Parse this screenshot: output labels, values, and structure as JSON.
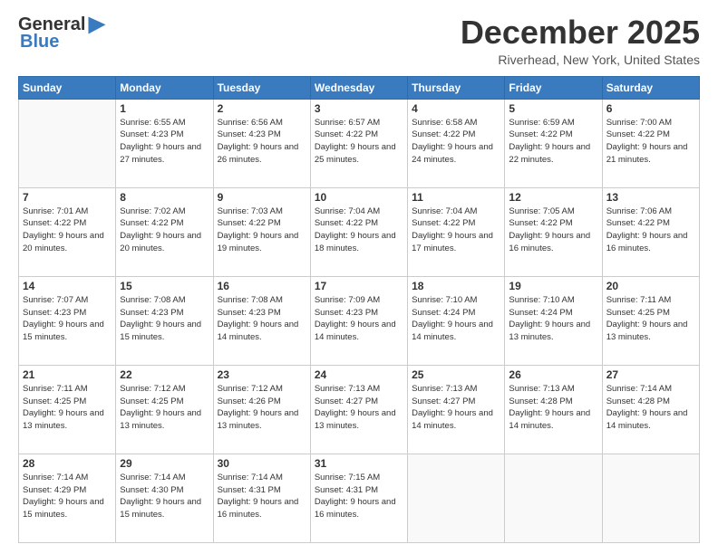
{
  "logo": {
    "general": "General",
    "blue": "Blue"
  },
  "title": "December 2025",
  "location": "Riverhead, New York, United States",
  "weekdays": [
    "Sunday",
    "Monday",
    "Tuesday",
    "Wednesday",
    "Thursday",
    "Friday",
    "Saturday"
  ],
  "weeks": [
    [
      {
        "day": "",
        "sunrise": "",
        "sunset": "",
        "daylight": ""
      },
      {
        "day": "1",
        "sunrise": "Sunrise: 6:55 AM",
        "sunset": "Sunset: 4:23 PM",
        "daylight": "Daylight: 9 hours and 27 minutes."
      },
      {
        "day": "2",
        "sunrise": "Sunrise: 6:56 AM",
        "sunset": "Sunset: 4:23 PM",
        "daylight": "Daylight: 9 hours and 26 minutes."
      },
      {
        "day": "3",
        "sunrise": "Sunrise: 6:57 AM",
        "sunset": "Sunset: 4:22 PM",
        "daylight": "Daylight: 9 hours and 25 minutes."
      },
      {
        "day": "4",
        "sunrise": "Sunrise: 6:58 AM",
        "sunset": "Sunset: 4:22 PM",
        "daylight": "Daylight: 9 hours and 24 minutes."
      },
      {
        "day": "5",
        "sunrise": "Sunrise: 6:59 AM",
        "sunset": "Sunset: 4:22 PM",
        "daylight": "Daylight: 9 hours and 22 minutes."
      },
      {
        "day": "6",
        "sunrise": "Sunrise: 7:00 AM",
        "sunset": "Sunset: 4:22 PM",
        "daylight": "Daylight: 9 hours and 21 minutes."
      }
    ],
    [
      {
        "day": "7",
        "sunrise": "Sunrise: 7:01 AM",
        "sunset": "Sunset: 4:22 PM",
        "daylight": "Daylight: 9 hours and 20 minutes."
      },
      {
        "day": "8",
        "sunrise": "Sunrise: 7:02 AM",
        "sunset": "Sunset: 4:22 PM",
        "daylight": "Daylight: 9 hours and 20 minutes."
      },
      {
        "day": "9",
        "sunrise": "Sunrise: 7:03 AM",
        "sunset": "Sunset: 4:22 PM",
        "daylight": "Daylight: 9 hours and 19 minutes."
      },
      {
        "day": "10",
        "sunrise": "Sunrise: 7:04 AM",
        "sunset": "Sunset: 4:22 PM",
        "daylight": "Daylight: 9 hours and 18 minutes."
      },
      {
        "day": "11",
        "sunrise": "Sunrise: 7:04 AM",
        "sunset": "Sunset: 4:22 PM",
        "daylight": "Daylight: 9 hours and 17 minutes."
      },
      {
        "day": "12",
        "sunrise": "Sunrise: 7:05 AM",
        "sunset": "Sunset: 4:22 PM",
        "daylight": "Daylight: 9 hours and 16 minutes."
      },
      {
        "day": "13",
        "sunrise": "Sunrise: 7:06 AM",
        "sunset": "Sunset: 4:22 PM",
        "daylight": "Daylight: 9 hours and 16 minutes."
      }
    ],
    [
      {
        "day": "14",
        "sunrise": "Sunrise: 7:07 AM",
        "sunset": "Sunset: 4:23 PM",
        "daylight": "Daylight: 9 hours and 15 minutes."
      },
      {
        "day": "15",
        "sunrise": "Sunrise: 7:08 AM",
        "sunset": "Sunset: 4:23 PM",
        "daylight": "Daylight: 9 hours and 15 minutes."
      },
      {
        "day": "16",
        "sunrise": "Sunrise: 7:08 AM",
        "sunset": "Sunset: 4:23 PM",
        "daylight": "Daylight: 9 hours and 14 minutes."
      },
      {
        "day": "17",
        "sunrise": "Sunrise: 7:09 AM",
        "sunset": "Sunset: 4:23 PM",
        "daylight": "Daylight: 9 hours and 14 minutes."
      },
      {
        "day": "18",
        "sunrise": "Sunrise: 7:10 AM",
        "sunset": "Sunset: 4:24 PM",
        "daylight": "Daylight: 9 hours and 14 minutes."
      },
      {
        "day": "19",
        "sunrise": "Sunrise: 7:10 AM",
        "sunset": "Sunset: 4:24 PM",
        "daylight": "Daylight: 9 hours and 13 minutes."
      },
      {
        "day": "20",
        "sunrise": "Sunrise: 7:11 AM",
        "sunset": "Sunset: 4:25 PM",
        "daylight": "Daylight: 9 hours and 13 minutes."
      }
    ],
    [
      {
        "day": "21",
        "sunrise": "Sunrise: 7:11 AM",
        "sunset": "Sunset: 4:25 PM",
        "daylight": "Daylight: 9 hours and 13 minutes."
      },
      {
        "day": "22",
        "sunrise": "Sunrise: 7:12 AM",
        "sunset": "Sunset: 4:25 PM",
        "daylight": "Daylight: 9 hours and 13 minutes."
      },
      {
        "day": "23",
        "sunrise": "Sunrise: 7:12 AM",
        "sunset": "Sunset: 4:26 PM",
        "daylight": "Daylight: 9 hours and 13 minutes."
      },
      {
        "day": "24",
        "sunrise": "Sunrise: 7:13 AM",
        "sunset": "Sunset: 4:27 PM",
        "daylight": "Daylight: 9 hours and 13 minutes."
      },
      {
        "day": "25",
        "sunrise": "Sunrise: 7:13 AM",
        "sunset": "Sunset: 4:27 PM",
        "daylight": "Daylight: 9 hours and 14 minutes."
      },
      {
        "day": "26",
        "sunrise": "Sunrise: 7:13 AM",
        "sunset": "Sunset: 4:28 PM",
        "daylight": "Daylight: 9 hours and 14 minutes."
      },
      {
        "day": "27",
        "sunrise": "Sunrise: 7:14 AM",
        "sunset": "Sunset: 4:28 PM",
        "daylight": "Daylight: 9 hours and 14 minutes."
      }
    ],
    [
      {
        "day": "28",
        "sunrise": "Sunrise: 7:14 AM",
        "sunset": "Sunset: 4:29 PM",
        "daylight": "Daylight: 9 hours and 15 minutes."
      },
      {
        "day": "29",
        "sunrise": "Sunrise: 7:14 AM",
        "sunset": "Sunset: 4:30 PM",
        "daylight": "Daylight: 9 hours and 15 minutes."
      },
      {
        "day": "30",
        "sunrise": "Sunrise: 7:14 AM",
        "sunset": "Sunset: 4:31 PM",
        "daylight": "Daylight: 9 hours and 16 minutes."
      },
      {
        "day": "31",
        "sunrise": "Sunrise: 7:15 AM",
        "sunset": "Sunset: 4:31 PM",
        "daylight": "Daylight: 9 hours and 16 minutes."
      },
      {
        "day": "",
        "sunrise": "",
        "sunset": "",
        "daylight": ""
      },
      {
        "day": "",
        "sunrise": "",
        "sunset": "",
        "daylight": ""
      },
      {
        "day": "",
        "sunrise": "",
        "sunset": "",
        "daylight": ""
      }
    ]
  ]
}
